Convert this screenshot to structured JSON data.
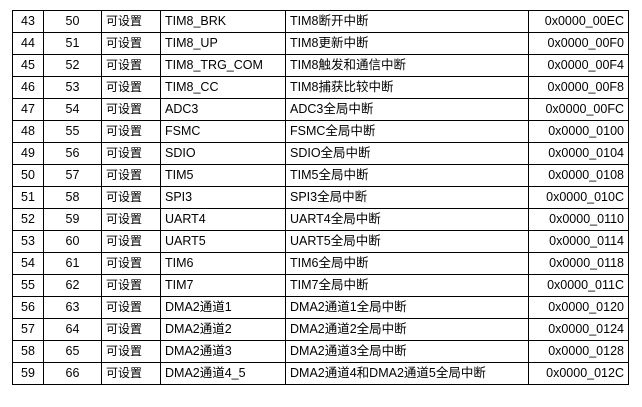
{
  "table": {
    "rows": [
      {
        "position": "43",
        "priority": "50",
        "type": "可设置",
        "name": "TIM8_BRK",
        "description": "TIM8断开中断",
        "address": "0x0000_00EC"
      },
      {
        "position": "44",
        "priority": "51",
        "type": "可设置",
        "name": "TIM8_UP",
        "description": "TIM8更新中断",
        "address": "0x0000_00F0"
      },
      {
        "position": "45",
        "priority": "52",
        "type": "可设置",
        "name": "TIM8_TRG_COM",
        "description": "TIM8触发和通信中断",
        "address": "0x0000_00F4"
      },
      {
        "position": "46",
        "priority": "53",
        "type": "可设置",
        "name": "TIM8_CC",
        "description": "TIM8捕获比较中断",
        "address": "0x0000_00F8"
      },
      {
        "position": "47",
        "priority": "54",
        "type": "可设置",
        "name": "ADC3",
        "description": "ADC3全局中断",
        "address": "0x0000_00FC"
      },
      {
        "position": "48",
        "priority": "55",
        "type": "可设置",
        "name": "FSMC",
        "description": "FSMC全局中断",
        "address": "0x0000_0100"
      },
      {
        "position": "49",
        "priority": "56",
        "type": "可设置",
        "name": "SDIO",
        "description": "SDIO全局中断",
        "address": "0x0000_0104"
      },
      {
        "position": "50",
        "priority": "57",
        "type": "可设置",
        "name": "TIM5",
        "description": "TIM5全局中断",
        "address": "0x0000_0108"
      },
      {
        "position": "51",
        "priority": "58",
        "type": "可设置",
        "name": "SPI3",
        "description": "SPI3全局中断",
        "address": "0x0000_010C"
      },
      {
        "position": "52",
        "priority": "59",
        "type": "可设置",
        "name": "UART4",
        "description": "UART4全局中断",
        "address": "0x0000_0110"
      },
      {
        "position": "53",
        "priority": "60",
        "type": "可设置",
        "name": "UART5",
        "description": "UART5全局中断",
        "address": "0x0000_0114"
      },
      {
        "position": "54",
        "priority": "61",
        "type": "可设置",
        "name": "TIM6",
        "description": "TIM6全局中断",
        "address": "0x0000_0118"
      },
      {
        "position": "55",
        "priority": "62",
        "type": "可设置",
        "name": "TIM7",
        "description": "TIM7全局中断",
        "address": "0x0000_011C"
      },
      {
        "position": "56",
        "priority": "63",
        "type": "可设置",
        "name": "DMA2通道1",
        "description": "DMA2通道1全局中断",
        "address": "0x0000_0120"
      },
      {
        "position": "57",
        "priority": "64",
        "type": "可设置",
        "name": "DMA2通道2",
        "description": "DMA2通道2全局中断",
        "address": "0x0000_0124"
      },
      {
        "position": "58",
        "priority": "65",
        "type": "可设置",
        "name": "DMA2通道3",
        "description": "DMA2通道3全局中断",
        "address": "0x0000_0128"
      },
      {
        "position": "59",
        "priority": "66",
        "type": "可设置",
        "name": "DMA2通道4_5",
        "description": "DMA2通道4和DMA2通道5全局中断",
        "address": "0x0000_012C"
      }
    ]
  }
}
